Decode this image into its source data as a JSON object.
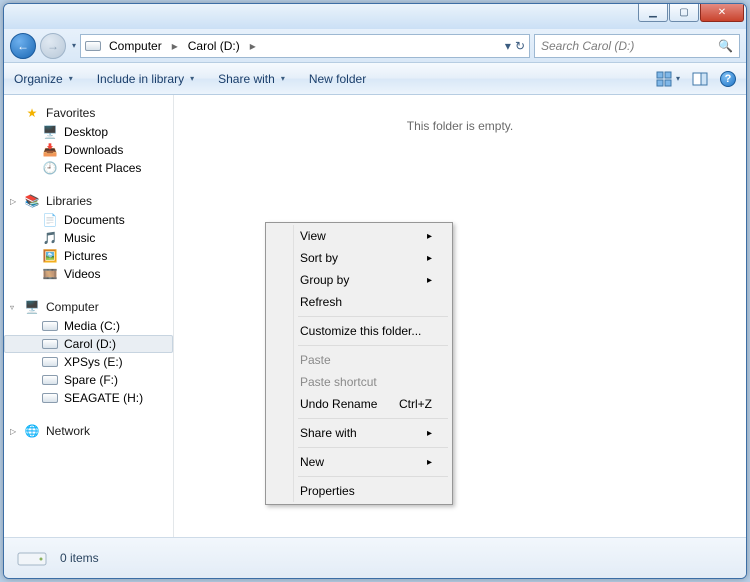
{
  "titlebar": {
    "min": "▁",
    "max": "▢",
    "close": "✕"
  },
  "nav": {
    "back_arrow": "←",
    "fwd_arrow": "→",
    "breadcrumb": {
      "root": "Computer",
      "current": "Carol (D:)"
    },
    "sep": "▸",
    "refresh_glyph": "↻",
    "dropdown": "▾"
  },
  "search": {
    "placeholder": "Search Carol (D:)",
    "icon": "🔍"
  },
  "toolbar": {
    "organize": "Organize",
    "include": "Include in library",
    "share": "Share with",
    "newfolder": "New folder"
  },
  "sidebar": {
    "favorites": {
      "head": "Favorites",
      "icon": "★",
      "items": [
        {
          "icon": "🖥️",
          "label": "Desktop"
        },
        {
          "icon": "📥",
          "label": "Downloads"
        },
        {
          "icon": "🕘",
          "label": "Recent Places"
        }
      ]
    },
    "libraries": {
      "head": "Libraries",
      "icon": "📚",
      "items": [
        {
          "icon": "📄",
          "label": "Documents"
        },
        {
          "icon": "🎵",
          "label": "Music"
        },
        {
          "icon": "🖼️",
          "label": "Pictures"
        },
        {
          "icon": "🎞️",
          "label": "Videos"
        }
      ]
    },
    "computer": {
      "head": "Computer",
      "icon": "🖥️",
      "items": [
        {
          "icon": "drive",
          "label": "Media (C:)"
        },
        {
          "icon": "drive",
          "label": "Carol (D:)",
          "selected": true
        },
        {
          "icon": "drive",
          "label": "XPSys (E:)"
        },
        {
          "icon": "drive",
          "label": "Spare (F:)"
        },
        {
          "icon": "drive",
          "label": "SEAGATE (H:)"
        }
      ]
    },
    "network": {
      "head": "Network",
      "icon": "🌐"
    }
  },
  "content": {
    "empty": "This folder is empty."
  },
  "contextmenu": {
    "view": "View",
    "sort": "Sort by",
    "group": "Group by",
    "refresh": "Refresh",
    "customize": "Customize this folder...",
    "paste": "Paste",
    "pasteshort": "Paste shortcut",
    "undo": "Undo Rename",
    "undo_key": "Ctrl+Z",
    "sharewith": "Share with",
    "new": "New",
    "properties": "Properties",
    "sub": "▸"
  },
  "status": {
    "count": "0 items"
  }
}
